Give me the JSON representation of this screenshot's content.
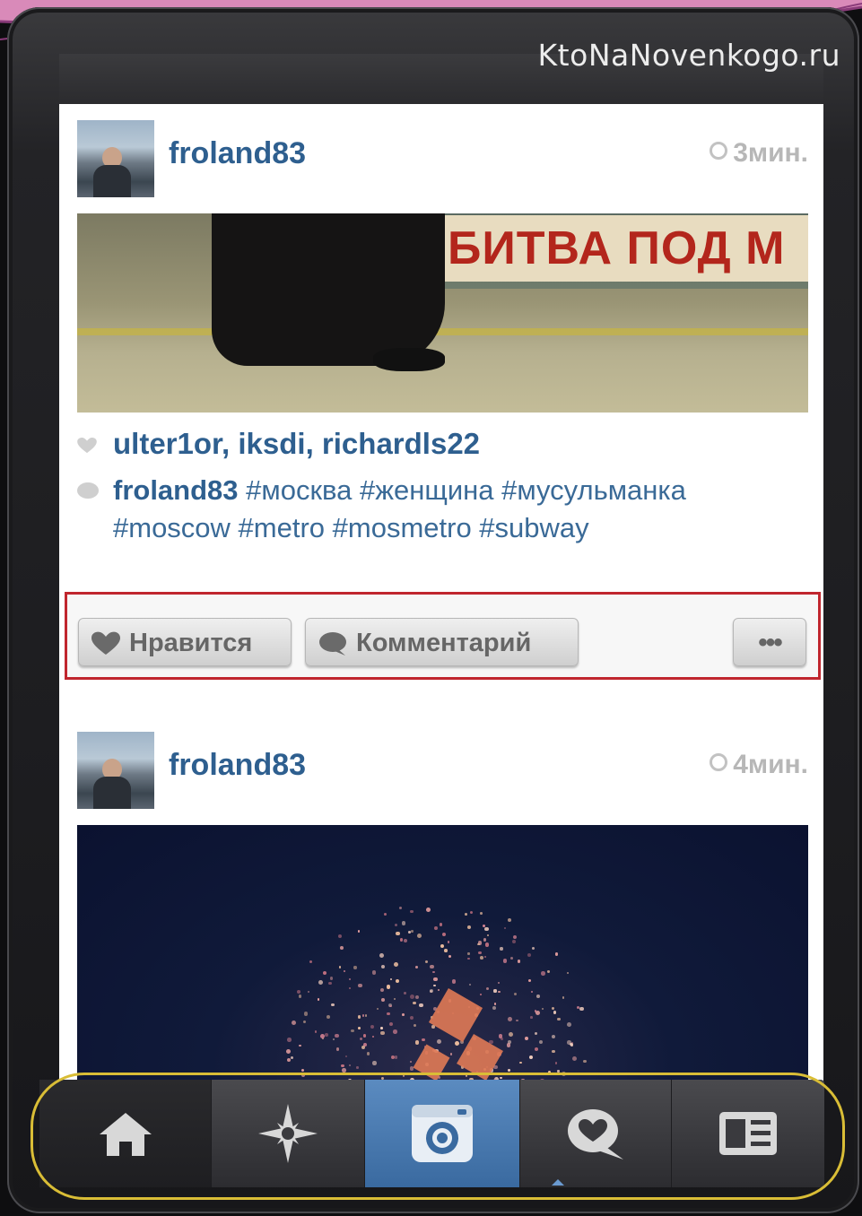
{
  "watermark": "KtoNaNovenkogo.ru",
  "posts": [
    {
      "username": "froland83",
      "time": "3мин.",
      "photo_sign": "БИТВА ПОД М",
      "likes": "ulter1or, iksdi, richardls22",
      "comment_author": "froland83",
      "comment_text": "#москва #женщина #мусульманка #moscow #metro #mosmetro #subway"
    },
    {
      "username": "froland83",
      "time": "4мин."
    }
  ],
  "actions": {
    "like_label": "Нравится",
    "comment_label": "Комментарий",
    "more_label": "•••"
  },
  "tabbar": {
    "items": [
      {
        "icon": "home-icon"
      },
      {
        "icon": "explore-icon"
      },
      {
        "icon": "camera-icon"
      },
      {
        "icon": "activity-icon"
      },
      {
        "icon": "profile-icon"
      }
    ]
  },
  "colors": {
    "username": "#2e5f8f",
    "highlight_box": "#c0262e",
    "highlight_oval": "#d9bd36",
    "camera_tab": "#4a7ab0"
  }
}
